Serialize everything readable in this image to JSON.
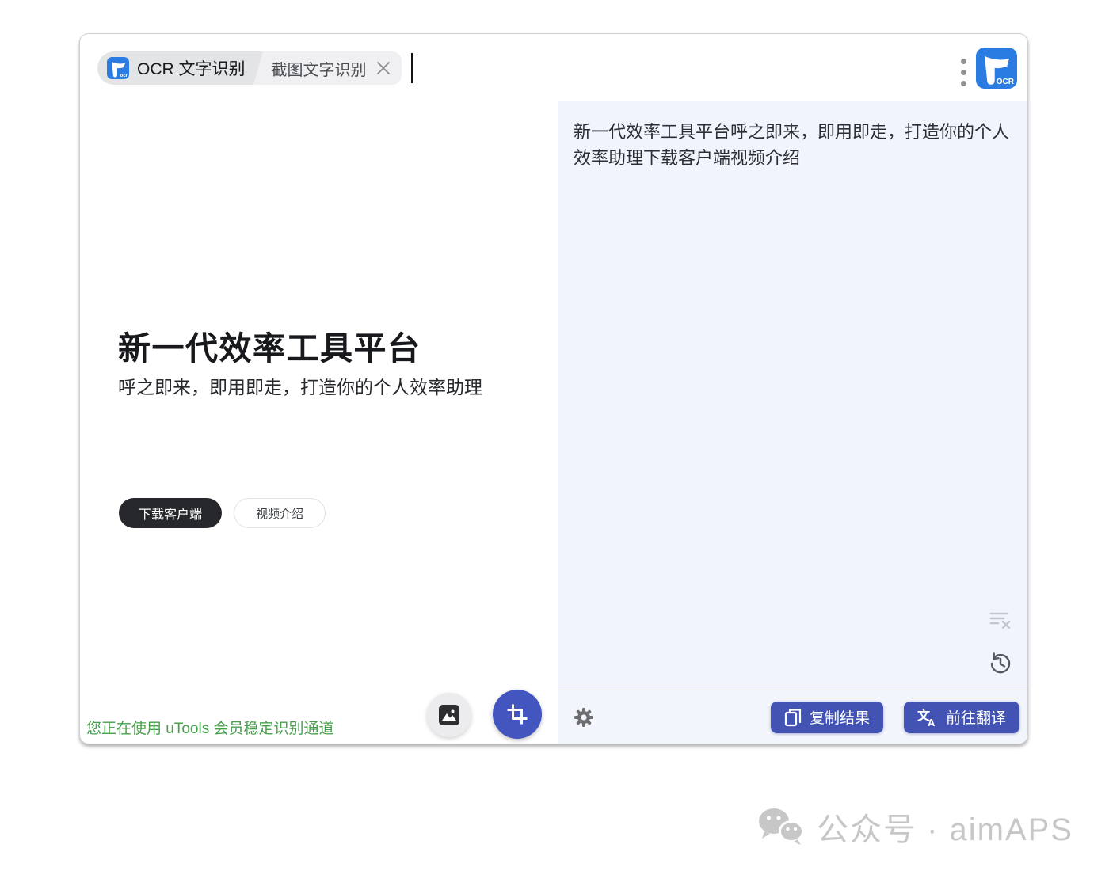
{
  "colors": {
    "accent_blue": "#2b7ce2",
    "button_indigo": "#4253b4",
    "crop_circle_blue": "#4355be",
    "panel_lavender": "#f1f4fc",
    "success_green": "#47a04b",
    "dark_button": "#26282b",
    "tab_primary_bg": "#e3e4e6",
    "tab_secondary_bg": "#f0f0f2",
    "watermark_gray": "#c7c7c7"
  },
  "header": {
    "tab_primary": "OCR 文字识别",
    "tab_secondary": "截图文字识别",
    "app_badge_label": "OCR",
    "tab_badge_label": "ocr"
  },
  "preview": {
    "heading": "新一代效率工具平台",
    "subtitle": "呼之即来，即用即走，打造你的个人效率助理",
    "download_button": "下载客户端",
    "video_button": "视频介绍",
    "status": "您正在使用 uTools 会员稳定识别通道"
  },
  "result": {
    "text": "新一代效率工具平台呼之即来，即用即走，打造你的个人效率助理下载客户端视频介绍",
    "copy_button": "复制结果",
    "translate_button": "前往翻译"
  },
  "icons": {
    "translate_glyph_main": "文",
    "translate_glyph_sub": "A"
  },
  "watermark": {
    "text": "公众号 · aimAPS"
  }
}
